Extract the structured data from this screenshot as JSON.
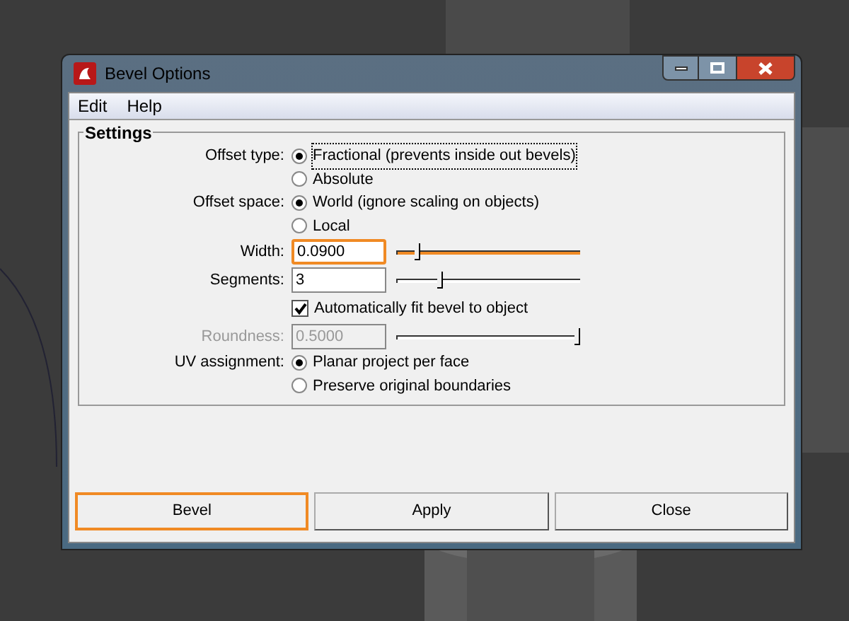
{
  "window": {
    "title": "Bevel Options"
  },
  "menu": [
    "Edit",
    "Help"
  ],
  "group": {
    "title": "Settings"
  },
  "rows": [
    {
      "kind": "radio",
      "label": "Offset type:",
      "options": [
        {
          "text": "Fractional (prevents inside out bevels)",
          "selected": true,
          "focused": true
        },
        {
          "text": "Absolute",
          "selected": false,
          "focused": false
        }
      ]
    },
    {
      "kind": "radio",
      "label": "Offset space:",
      "options": [
        {
          "text": "World (ignore scaling on objects)",
          "selected": true,
          "focused": false
        },
        {
          "text": "Local",
          "selected": false,
          "focused": false
        }
      ]
    },
    {
      "kind": "slider",
      "label": "Width:",
      "value": "0.0900",
      "focused": true,
      "disabled": false,
      "level": 0.1
    },
    {
      "kind": "slider",
      "label": "Segments:",
      "value": "3",
      "focused": false,
      "disabled": false,
      "level": 0.23
    },
    {
      "kind": "checkbox",
      "text": "Automatically fit bevel to object",
      "checked": true
    },
    {
      "kind": "slider",
      "label": "Roundness:",
      "value": "0.5000",
      "focused": false,
      "disabled": true,
      "level": 1
    },
    {
      "kind": "radio",
      "label": "UV assignment:",
      "options": [
        {
          "text": "Planar project per face",
          "selected": true,
          "focused": false
        },
        {
          "text": "Preserve original boundaries",
          "selected": false,
          "focused": false
        }
      ]
    }
  ],
  "buttons": [
    {
      "label": "Bevel",
      "focused": true
    },
    {
      "label": "Apply",
      "focused": false
    },
    {
      "label": "Close",
      "focused": false
    }
  ]
}
